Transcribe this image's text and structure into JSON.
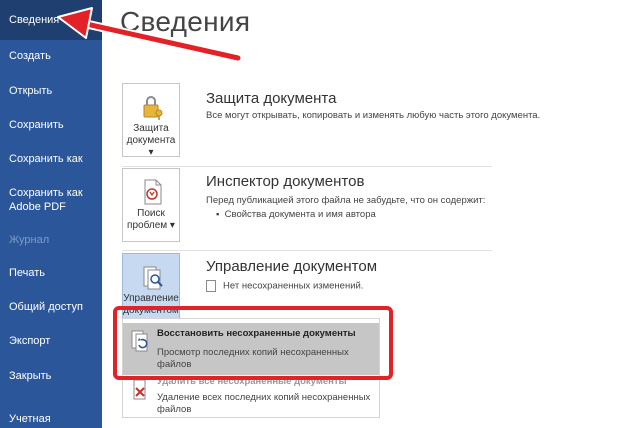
{
  "sidebar": {
    "items": [
      {
        "label": "Сведения"
      },
      {
        "label": "Создать"
      },
      {
        "label": "Открыть"
      },
      {
        "label": "Сохранить"
      },
      {
        "label": "Сохранить как"
      },
      {
        "label": "Сохранить как",
        "label2": "Adobe PDF"
      },
      {
        "label": "Журнал"
      },
      {
        "label": "Печать"
      },
      {
        "label": "Общий доступ"
      },
      {
        "label": "Экспорт"
      },
      {
        "label": "Закрыть"
      },
      {
        "label": "Учетная"
      }
    ]
  },
  "main": {
    "title": "Сведения",
    "sections": [
      {
        "button_line1": "Защита",
        "button_line2": "документа ▾",
        "title": "Защита документа",
        "desc": "Все могут открывать, копировать и изменять любую часть этого документа."
      },
      {
        "button_line1": "Поиск",
        "button_line2": "проблем ▾",
        "title": "Инспектор документов",
        "desc": "Перед публикацией этого файла не забудьте, что он содержит:",
        "bullet": "Свойства документа и имя автора"
      },
      {
        "button_line1": "Управление",
        "button_line2": "документом",
        "title": "Управление документом",
        "desc": "Нет несохраненных изменений."
      }
    ],
    "dropdown": {
      "items": [
        {
          "title": "Восстановить несохраненные документы",
          "desc": "Просмотр последних копий несохраненных файлов"
        },
        {
          "title": "Удалить все несохраненные документы",
          "desc": "Удаление всех последних копий несохраненных файлов"
        }
      ]
    }
  },
  "colors": {
    "sidebar_bg": "#2b579a",
    "sidebar_active": "#1e3f70",
    "highlight": "#e32227",
    "selected_item": "#c6c6c6"
  }
}
